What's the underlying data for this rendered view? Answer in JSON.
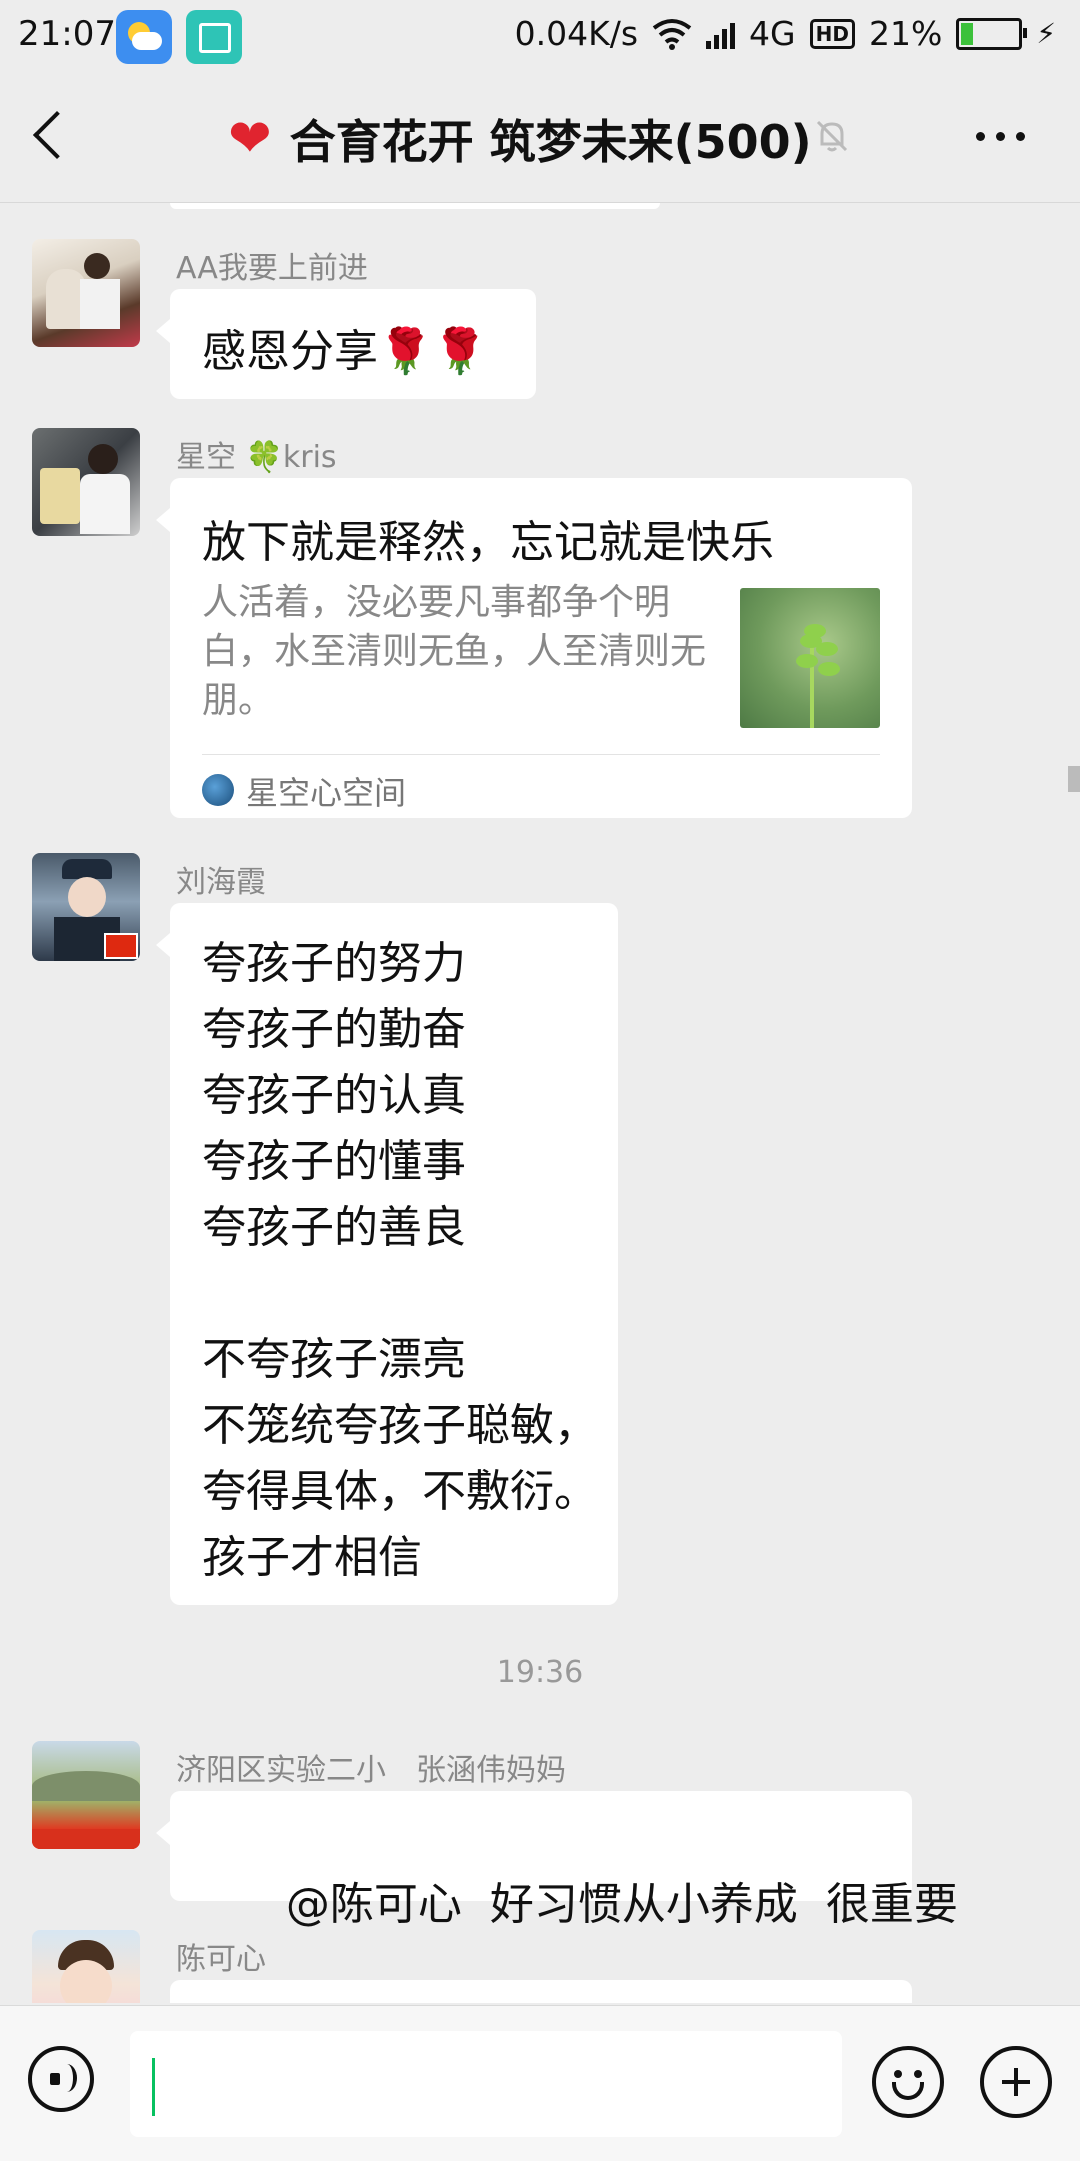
{
  "status_bar": {
    "time": "21:07",
    "network_speed": "0.04K/s",
    "network_type": "4G",
    "hd_label": "HD",
    "battery_percent": "21%",
    "battery_level": 0.21
  },
  "header": {
    "title": "合育花开 筑梦未来(500)",
    "title_icon": "heart-icon",
    "muted": true
  },
  "messages": [
    {
      "sender": "AA我要上前进",
      "text": "感恩分享🌹🌹",
      "type": "text"
    },
    {
      "sender": "星空 🍀kris",
      "type": "link",
      "card": {
        "title": "放下就是释然，忘记就是快乐",
        "description": "人活着，没必要凡事都争个明白，水至清则无鱼，人至清则无朋。",
        "source": "星空心空间"
      }
    },
    {
      "sender": "刘海霞",
      "type": "text",
      "text": "夸孩子的努力\n夸孩子的勤奋\n夸孩子的认真\n夸孩子的懂事\n夸孩子的善良\n\n不夸孩子漂亮\n不笼统夸孩子聪敏，\n夸得具体，不敷衍。\n孩子才相信"
    },
    {
      "type": "timestamp",
      "time": "19:36"
    },
    {
      "sender": "济阳区实验二小　张涵伟妈妈",
      "type": "text",
      "text": "@陈可心  好习惯从小养成  很重要"
    },
    {
      "sender": "陈可心",
      "type": "text",
      "text": ""
    }
  ],
  "input_bar": {
    "value": "",
    "placeholder": ""
  },
  "colors": {
    "background": "#ededed",
    "bubble": "#ffffff",
    "caret": "#07c160",
    "heart": "#e0242f"
  }
}
